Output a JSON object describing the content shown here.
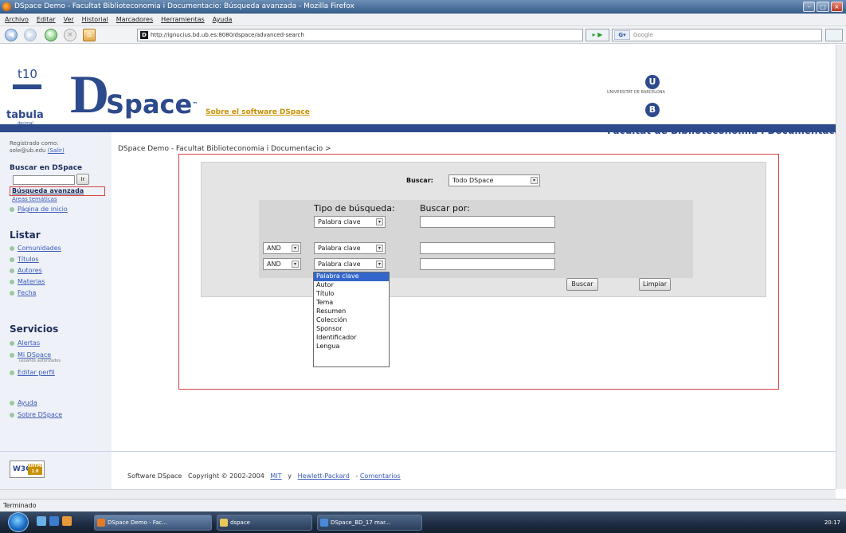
{
  "window": {
    "title": "DSpace Demo - Facultat Biblioteconomia i Documentacio: Búsqueda avanzada - Mozilla Firefox"
  },
  "menu": [
    "Archivo",
    "Editar",
    "Ver",
    "Historial",
    "Marcadores",
    "Herramientas",
    "Ayuda"
  ],
  "nav": {
    "url": "http://ignucius.bd.ub.es:8080/dspace/advanced-search",
    "search_placeholder": "Google"
  },
  "header": {
    "tabula_top": "t10",
    "tabula_name": "tabula",
    "tabula_sub": "decimal",
    "dspace_d": "D",
    "dspace_rest": "Space",
    "tm": "™",
    "sobre": "Sobre el software DSpace",
    "ub_small": "UNIVERSITAT DE BARCELONA",
    "ub_u": "U",
    "ub_b": "B",
    "faculty": "Facultat de Biblioteconomia i Documentació"
  },
  "sidebar": {
    "registered": "Registrado como:",
    "user": "sole@ub.edu",
    "exit": "(Salir)",
    "search_title": "Buscar en DSpace",
    "go": "Ir",
    "advanced": "Búsqueda avanzada",
    "areas": "Áreas temáticas",
    "home": "Página de inicio",
    "listar": "Listar",
    "browse": [
      "Comunidades",
      "Títulos",
      "Autores",
      "Materias",
      "Fecha"
    ],
    "servicios": "Servicios",
    "alertas": "Alertas",
    "midspace": "Mi DSpace",
    "midspace_sub": "usuarios autorizados",
    "editar": "Editar perfil",
    "ayuda": "Ayuda",
    "sobre": "Sobre DSpace"
  },
  "breadcrumb": "DSpace Demo - Facultat Biblioteconomia i Documentacio >",
  "form": {
    "buscar_label": "Buscar:",
    "scope": "Todo DSpace",
    "tipo_label": "Tipo de búsqueda:",
    "buscar_por": "Buscar por:",
    "row1_field": "Palabra clave",
    "row2_op": "AND",
    "row2_field": "Palabra clave",
    "row3_op": "AND",
    "row3_field": "Palabra clave",
    "submit": "Buscar",
    "clear": "Limpiar"
  },
  "dropdown": [
    "Palabra clave",
    "Autor",
    "Título",
    "Tema",
    "Resumen",
    "Colección",
    "Sponsor",
    "Identificador",
    "Lengua"
  ],
  "footer": {
    "w3c": "W3C",
    "xhtml": "XHTML 1.0",
    "software": "Software DSpace",
    "copyright": "Copyright © 2002-2004",
    "mit": "MIT",
    "and": "y",
    "hp": "Hewlett-Packard",
    "dash": "-",
    "comments": "Comentarios"
  },
  "status": "Terminado",
  "taskbar": [
    "DSpace Demo - Fac...",
    "dspace",
    "DSpace_BD_17 mar..."
  ],
  "clock": "20:17"
}
